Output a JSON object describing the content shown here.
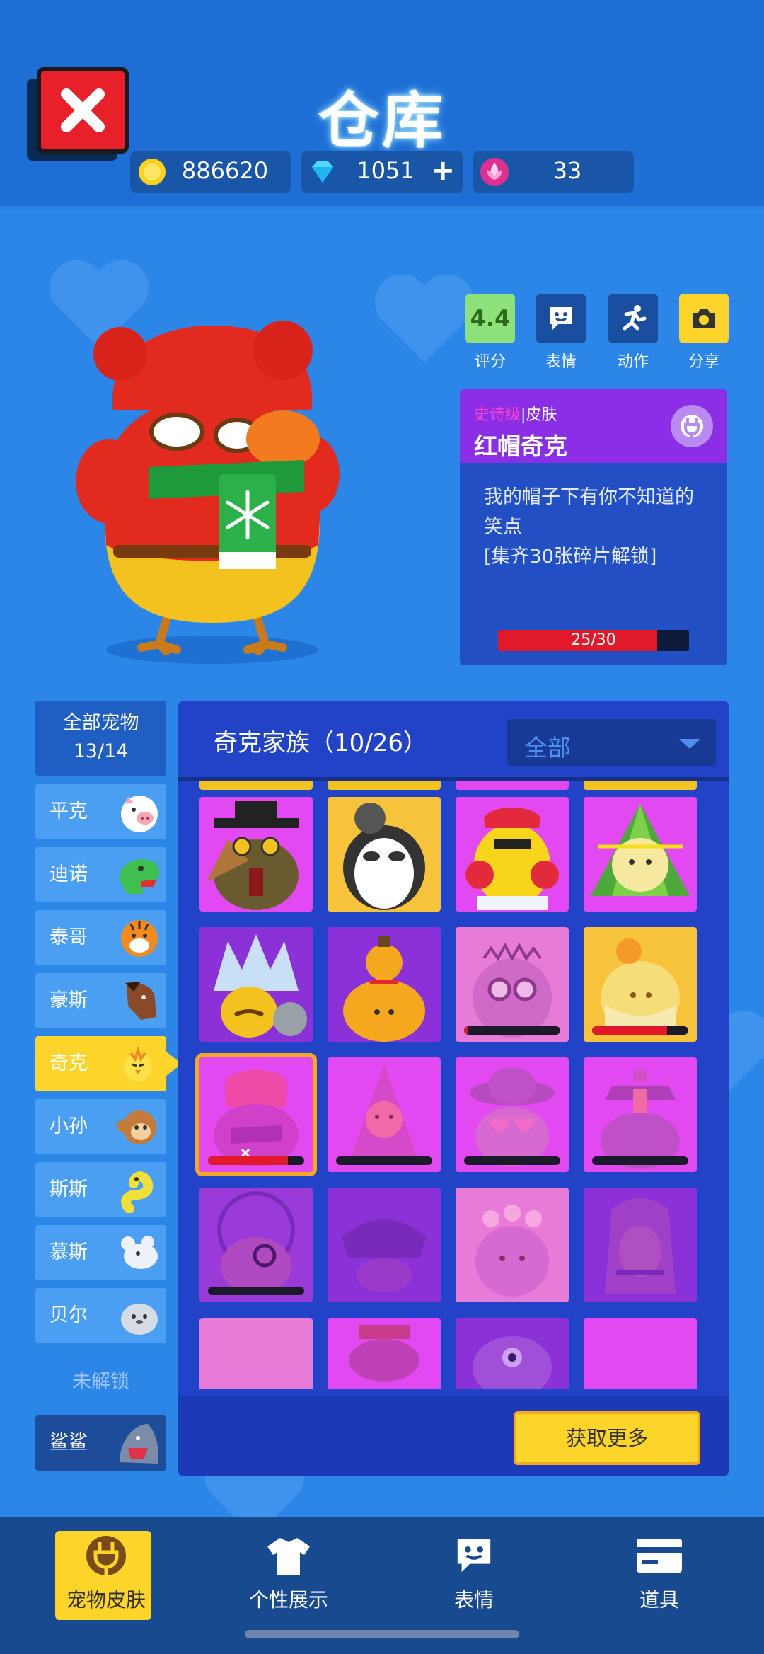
{
  "header": {
    "title": "仓库",
    "currencies": [
      {
        "icon": "coin-icon",
        "value": "886620"
      },
      {
        "icon": "diamond-icon",
        "value": "1051"
      },
      {
        "icon": "flower-token-icon",
        "value": "33"
      }
    ],
    "plus_label": "+"
  },
  "actions": [
    {
      "value": "4.4",
      "label": "评分"
    },
    {
      "icon": "emote-icon",
      "label": "表情"
    },
    {
      "icon": "running-icon",
      "label": "动作"
    },
    {
      "icon": "camera-icon",
      "label": "分享"
    }
  ],
  "skin": {
    "tier": "史诗级",
    "separator": "|",
    "type": "皮肤",
    "name": "红帽奇克",
    "desc_line1": "我的帽子下有你不知道的",
    "desc_line2": "笑点",
    "desc_line3": "[集齐30张碎片解锁]",
    "progress_text": "25/30",
    "progress": 0.833
  },
  "pets": {
    "all_label": "全部宠物",
    "all_count": "13/14",
    "items": [
      {
        "label": "平克",
        "face": "pig-icon"
      },
      {
        "label": "迪诺",
        "face": "dino-icon"
      },
      {
        "label": "泰哥",
        "face": "tiger-icon"
      },
      {
        "label": "豪斯",
        "face": "horse-icon"
      },
      {
        "label": "奇克",
        "face": "chick-icon",
        "active": true
      },
      {
        "label": "小孙",
        "face": "monkey-icon"
      },
      {
        "label": "斯斯",
        "face": "snake-icon"
      },
      {
        "label": "慕斯",
        "face": "mouse-icon"
      },
      {
        "label": "贝尔",
        "face": "seal-icon"
      }
    ],
    "locked_label": "未解锁",
    "locked_items": [
      {
        "label": "鲨鲨",
        "face": "shark-icon"
      }
    ]
  },
  "grid": {
    "family": "奇克家族（10/26）",
    "filter": "全部",
    "more_button": "获取更多"
  },
  "nav": [
    {
      "label": "宠物皮肤",
      "icon": "pet-skin-icon",
      "active": true
    },
    {
      "label": "个性展示",
      "icon": "shirt-icon"
    },
    {
      "label": "表情",
      "icon": "emote-icon"
    },
    {
      "label": "道具",
      "icon": "card-icon"
    }
  ],
  "colors": {
    "background": "#2b86e8",
    "accent_yellow": "#fcd42a",
    "epic_purple": "#8a2fe6",
    "progress_red": "#e01a2b"
  }
}
